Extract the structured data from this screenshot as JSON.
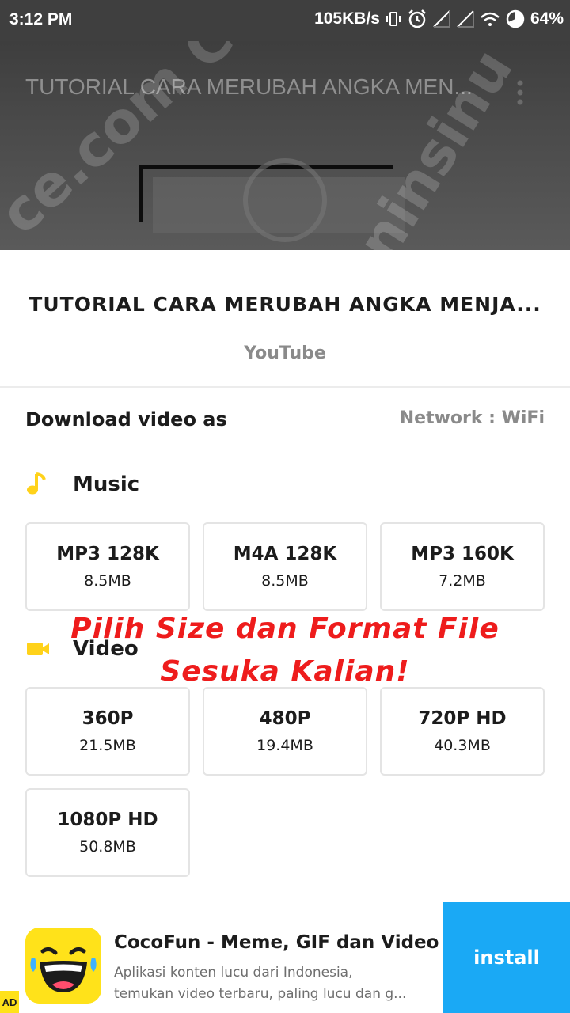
{
  "status_bar": {
    "time": "3:12 PM",
    "speed": "105KB/s",
    "battery": "64%",
    "icons": [
      "vibrate-icon",
      "alarm-icon",
      "signal-icon",
      "signal-icon",
      "wifi-icon",
      "battery-icon"
    ]
  },
  "video": {
    "title": "TUTORIAL CARA MERUBAH ANGKA MEN...",
    "watermark_left": "ce.com Calo",
    "watermark_right": "oninsinu"
  },
  "sheet": {
    "title": "TUTORIAL CARA MERUBAH ANGKA MENJA...",
    "source": "YouTube",
    "download_label": "Download video as",
    "network": "Network : WiFi"
  },
  "music": {
    "label": "Music",
    "icon": "music-note-icon",
    "options": [
      {
        "format": "MP3 128K",
        "size": "8.5MB"
      },
      {
        "format": "M4A 128K",
        "size": "8.5MB"
      },
      {
        "format": "MP3 160K",
        "size": "7.2MB"
      }
    ]
  },
  "video_section": {
    "label": "Video",
    "icon": "video-camera-icon",
    "options": [
      {
        "format": "360P",
        "size": "21.5MB"
      },
      {
        "format": "480P",
        "size": "19.4MB"
      },
      {
        "format": "720P HD",
        "size": "40.3MB"
      },
      {
        "format": "1080P HD",
        "size": "50.8MB"
      }
    ]
  },
  "overlay": {
    "line1": "Pilih Size dan Format File",
    "line2": "Sesuka Kalian!"
  },
  "ad": {
    "app_name": "CocoFun - Meme, GIF dan Video",
    "desc_line1": "Aplikasi konten lucu dari Indonesia,",
    "desc_line2": "temukan video terbaru, paling lucu dan g...",
    "install": "install",
    "badge": "AD"
  },
  "colors": {
    "accent_yellow": "#ffd21a",
    "install_blue": "#1aa9f5",
    "overlay_red": "#ee1c1c"
  }
}
